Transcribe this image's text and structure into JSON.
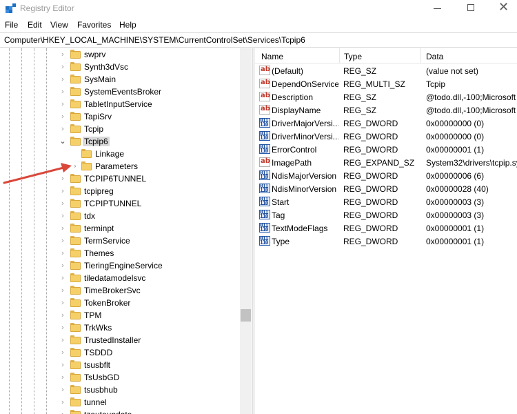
{
  "window": {
    "title": "Registry Editor"
  },
  "menu": [
    "File",
    "Edit",
    "View",
    "Favorites",
    "Help"
  ],
  "address": "Computer\\HKEY_LOCAL_MACHINE\\SYSTEM\\CurrentControlSet\\Services\\Tcpip6",
  "tree": {
    "items": [
      {
        "label": "swprv"
      },
      {
        "label": "Synth3dVsc"
      },
      {
        "label": "SysMain"
      },
      {
        "label": "SystemEventsBroker"
      },
      {
        "label": "TabletInputService"
      },
      {
        "label": "TapiSrv"
      },
      {
        "label": "Tcpip"
      },
      {
        "label": "Tcpip6",
        "expanded": true,
        "selected": true
      },
      {
        "label": "Linkage",
        "child": true,
        "no_chevron": true
      },
      {
        "label": "Parameters",
        "child": true
      },
      {
        "label": "TCPIP6TUNNEL"
      },
      {
        "label": "tcpipreg"
      },
      {
        "label": "TCPIPTUNNEL"
      },
      {
        "label": "tdx"
      },
      {
        "label": "terminpt"
      },
      {
        "label": "TermService"
      },
      {
        "label": "Themes"
      },
      {
        "label": "TieringEngineService"
      },
      {
        "label": "tiledatamodelsvc"
      },
      {
        "label": "TimeBrokerSvc"
      },
      {
        "label": "TokenBroker"
      },
      {
        "label": "TPM"
      },
      {
        "label": "TrkWks"
      },
      {
        "label": "TrustedInstaller"
      },
      {
        "label": "TSDDD"
      },
      {
        "label": "tsusbflt"
      },
      {
        "label": "TsUsbGD"
      },
      {
        "label": "tsusbhub"
      },
      {
        "label": "tunnel"
      },
      {
        "label": "tzautoupdate"
      }
    ]
  },
  "list": {
    "columns": [
      "Name",
      "Type",
      "Data"
    ],
    "rows": [
      {
        "icon": "string-value-icon",
        "name": "(Default)",
        "type": "REG_SZ",
        "data": "(value not set)"
      },
      {
        "icon": "string-value-icon",
        "name": "DependOnService",
        "type": "REG_MULTI_SZ",
        "data": "Tcpip"
      },
      {
        "icon": "string-value-icon",
        "name": "Description",
        "type": "REG_SZ",
        "data": "@todo.dll,-100;Microsoft"
      },
      {
        "icon": "string-value-icon",
        "name": "DisplayName",
        "type": "REG_SZ",
        "data": "@todo.dll,-100;Microsoft"
      },
      {
        "icon": "binary-value-icon",
        "name": "DriverMajorVersi...",
        "type": "REG_DWORD",
        "data": "0x00000000 (0)"
      },
      {
        "icon": "binary-value-icon",
        "name": "DriverMinorVersi...",
        "type": "REG_DWORD",
        "data": "0x00000000 (0)"
      },
      {
        "icon": "binary-value-icon",
        "name": "ErrorControl",
        "type": "REG_DWORD",
        "data": "0x00000001 (1)"
      },
      {
        "icon": "string-value-icon",
        "name": "ImagePath",
        "type": "REG_EXPAND_SZ",
        "data": "System32\\drivers\\tcpip.sy"
      },
      {
        "icon": "binary-value-icon",
        "name": "NdisMajorVersion",
        "type": "REG_DWORD",
        "data": "0x00000006 (6)"
      },
      {
        "icon": "binary-value-icon",
        "name": "NdisMinorVersion",
        "type": "REG_DWORD",
        "data": "0x00000028 (40)"
      },
      {
        "icon": "binary-value-icon",
        "name": "Start",
        "type": "REG_DWORD",
        "data": "0x00000003 (3)"
      },
      {
        "icon": "binary-value-icon",
        "name": "Tag",
        "type": "REG_DWORD",
        "data": "0x00000003 (3)"
      },
      {
        "icon": "binary-value-icon",
        "name": "TextModeFlags",
        "type": "REG_DWORD",
        "data": "0x00000001 (1)"
      },
      {
        "icon": "binary-value-icon",
        "name": "Type",
        "type": "REG_DWORD",
        "data": "0x00000001 (1)"
      }
    ]
  },
  "icon_glyphs": {
    "string": "ab",
    "binary": "011\n110"
  },
  "colors": {
    "selection": "#d9d9d9",
    "folder": "#f5cf67",
    "annotation_arrow": "#d9473a"
  }
}
